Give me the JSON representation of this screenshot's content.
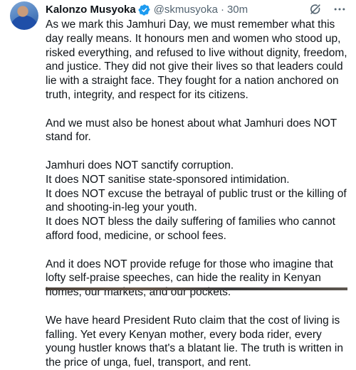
{
  "tweet": {
    "author_name": "Kalonzo Musyoka",
    "handle": "@skmusyoka",
    "separator": "·",
    "time": "30m",
    "verified_color": "#1d9bf0",
    "avatar_icon": "profile-photo",
    "actions": {
      "grok_icon": "grok-icon",
      "more_icon": "more-options-icon"
    },
    "paragraphs": [
      "As we mark this Jamhuri Day, we must remember what this day really means. It honours men and women who stood up, risked everything, and refused to live without dignity, freedom, and justice. They did not give their lives so that leaders could lie with a straight face. They fought for a nation anchored on truth, integrity, and respect for its citizens.",
      "And we must also be honest about what Jamhuri does NOT stand for.",
      "Jamhuri does NOT sanctify corruption.\nIt does NOT sanitise state-sponsored intimidation.\nIt does NOT excuse the betrayal of public trust or the killing of and shooting-in-leg your youth.\nIt does NOT bless the daily suffering of families who cannot afford food, medicine, or school fees.",
      "And it does NOT provide refuge for those who imagine that lofty self-praise speeches, can hide the reality in Kenyan homes, our markets, and our pockets.",
      "We have heard President Ruto claim that the cost of living is falling. Yet every Kenyan mother, every boda rider, every young hustler knows that's a blatant lie. The truth is written in the price of unga, fuel, transport, and rent."
    ]
  }
}
